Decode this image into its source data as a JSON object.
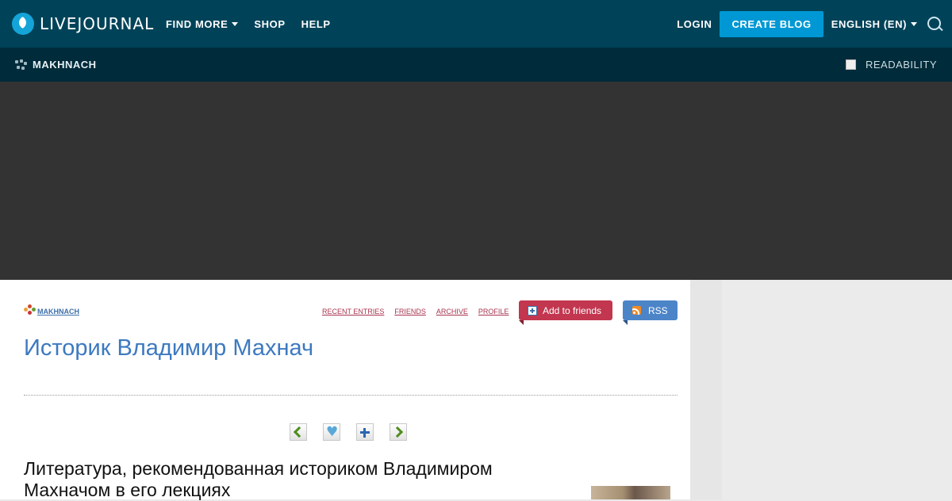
{
  "header": {
    "logo_text": "LIVEJOURNAL",
    "nav": [
      {
        "label": "FIND MORE",
        "has_dropdown": true
      },
      {
        "label": "SHOP",
        "has_dropdown": false
      },
      {
        "label": "HELP",
        "has_dropdown": false
      }
    ],
    "login_label": "LOGIN",
    "create_blog_label": "CREATE BLOG",
    "language_label": "ENGLISH (EN)",
    "search_icon": "search-icon"
  },
  "subbar": {
    "journal_name": "MAKHNACH",
    "readability_label": "READABILITY"
  },
  "journal": {
    "user_link": "MAKHNACH",
    "nav_links": [
      "RECENT ENTRIES",
      "FRIENDS",
      "ARCHIVE",
      "PROFILE"
    ],
    "add_friends_label": "Add to friends",
    "rss_label": "RSS",
    "title": "Историк Владимир Махнач"
  },
  "entry": {
    "title": "Литература, рекомендованная историком Владимиром Махначом в его лекциях"
  },
  "colors": {
    "topbar": "#004359",
    "subbar": "#002b3a",
    "accent": "#0098d4",
    "add_friends": "#c2364f",
    "rss": "#4c84c8",
    "title_blue": "#3d79c0"
  }
}
